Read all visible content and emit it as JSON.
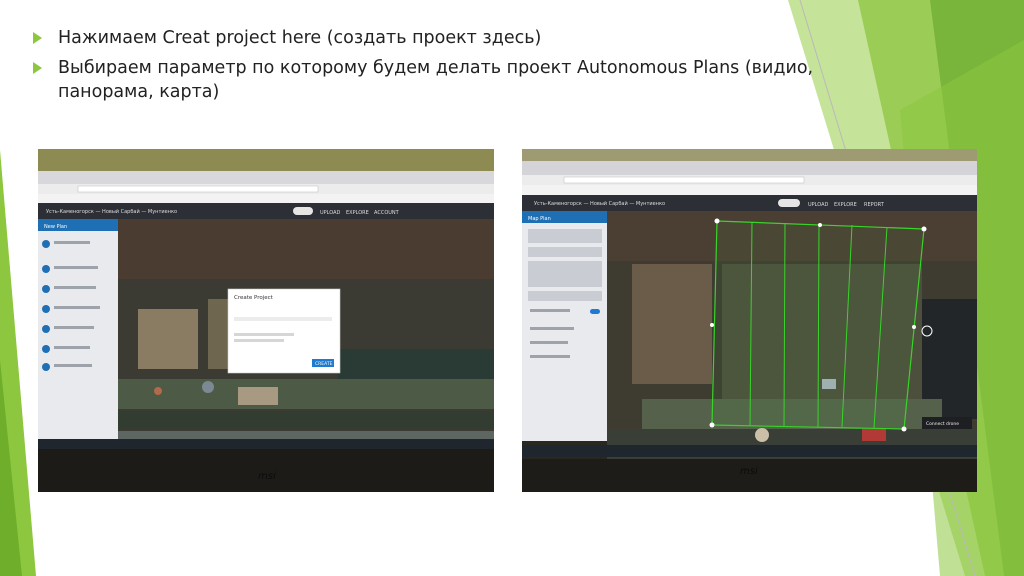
{
  "bullets": [
    "Нажимаем Creat project here (создать проект здесь)",
    "Выбираем параметр по которому будем делать проект Autonomous Plans (видио, панорама, карта)"
  ],
  "photo1": {
    "location": "Усть-Каменогорск — Новый Сарбай — Мунтиенко",
    "tabs": [
      "UPLOAD",
      "EXPLORE",
      "ACCOUNT"
    ],
    "sidebar_title": "New Plan",
    "dialog_title": "Create Project",
    "dialog_button": "CREATE",
    "taskbar_brand": "msi"
  },
  "photo2": {
    "location": "Усть-Каменогорск — Новый Сарбай — Мунтиенко",
    "tabs": [
      "UPLOAD",
      "EXPLORE",
      "REPORT"
    ],
    "sidebar_title": "Map Plan",
    "connect_label": "Connect drone",
    "taskbar_brand": "msi"
  },
  "colors": {
    "accent": "#8dc63f",
    "flight_path": "#39d42a"
  }
}
